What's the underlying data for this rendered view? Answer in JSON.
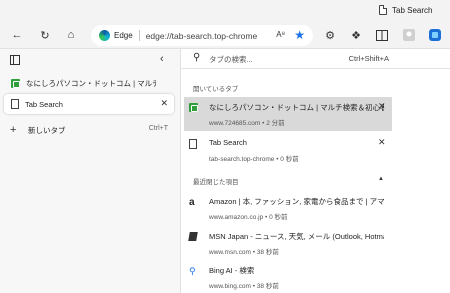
{
  "window": {
    "tab_title": "Tab Search"
  },
  "toolbar": {
    "brand": "Edge",
    "url": "edge://tab-search.top-chrome",
    "read_aloud_icon": "A͉"
  },
  "sidebar": {
    "tabs": [
      {
        "label": "なにしろパソコン・ドットコム | マルチ検索＆初心者…",
        "icon": "green-favicon"
      },
      {
        "label": "Tab Search",
        "icon": "doc-icon"
      }
    ],
    "new_tab": {
      "label": "新しいタブ",
      "shortcut": "Ctrl+T"
    }
  },
  "panel": {
    "search_placeholder": "タブの検索...",
    "search_shortcut": "Ctrl+Shift+A",
    "open_section": "開いているタブ",
    "open_tabs": [
      {
        "title": "なにしろパソコン・ドットコム | マルチ検索＆初心者…",
        "sub": "www.724685.com • 2 分前"
      },
      {
        "title": "Tab Search",
        "sub": "tab-search.top-chrome • 0 秒前"
      }
    ],
    "recent_section": "最近閉じた項目",
    "recent": [
      {
        "title": "Amazon | 本, ファッション, 家電から食品まで | アマゾン",
        "sub": "www.amazon.co.jp • 0 秒前",
        "icon": "amazon-icon"
      },
      {
        "title": "MSN Japan - ニュース, 天気, メール (Outlook, Hotmail…",
        "sub": "www.msn.com • 38 秒前",
        "icon": "msn-icon"
      },
      {
        "title": "Bing AI - 検索",
        "sub": "www.bing.com • 38 秒前",
        "icon": "bing-icon"
      }
    ]
  }
}
